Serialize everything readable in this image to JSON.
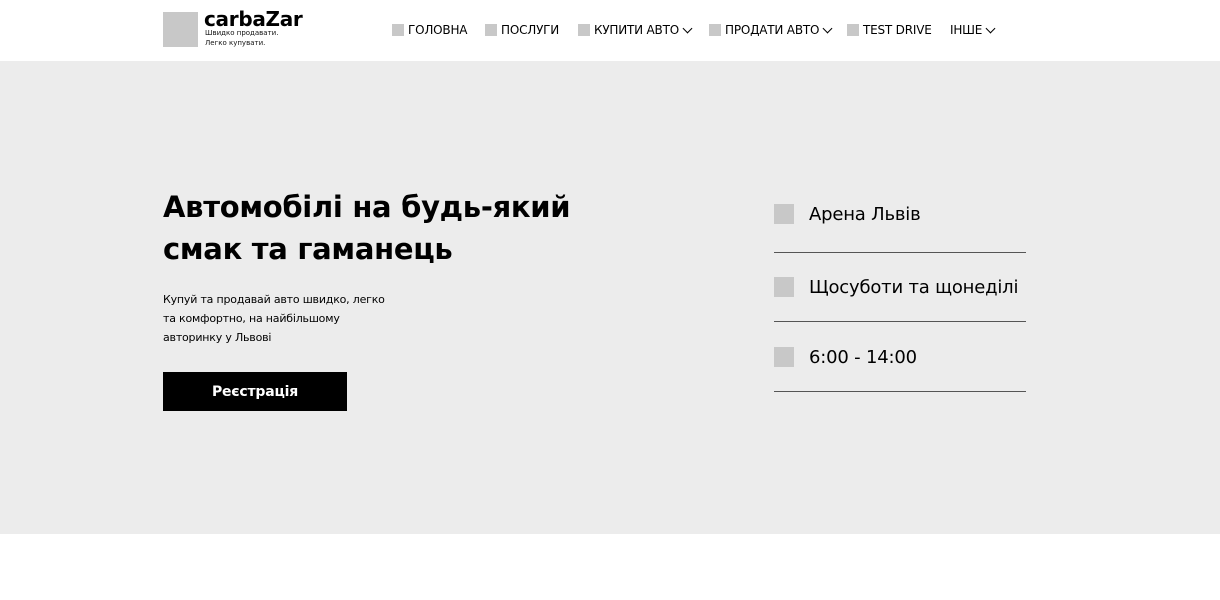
{
  "header": {
    "logo_name": "carbaZar",
    "logo_tagline_1": "Швидко продавати.",
    "logo_tagline_2": "Легко купувати.",
    "nav": [
      {
        "label": "ГОЛОВНА",
        "icon": "square-icon",
        "dropdown": false
      },
      {
        "label": "ПОСЛУГИ",
        "icon": "square-icon",
        "dropdown": false
      },
      {
        "label": "КУПИТИ АВТО",
        "icon": "square-icon",
        "dropdown": true
      },
      {
        "label": "ПРОДАТИ АВТО",
        "icon": "square-icon",
        "dropdown": true
      },
      {
        "label": "TEST DRIVE",
        "icon": "square-icon",
        "dropdown": false
      },
      {
        "label": "ІНШЕ",
        "icon": null,
        "dropdown": true
      }
    ]
  },
  "hero": {
    "title_line1": "Автомобілі на будь-який",
    "title_line2": "смак та гаманець",
    "text_line1": "Купуй та продавай авто швидко, легко",
    "text_line2": "та комфортно, на найбільшому",
    "text_line3": "авторинку у Львові",
    "button_label": "Реєстрація",
    "info": [
      {
        "icon": "location-icon",
        "text": "Арена Львів"
      },
      {
        "icon": "calendar-icon",
        "text": "Щосуботи та щонеділі"
      },
      {
        "icon": "clock-icon",
        "text": "6:00 - 14:00"
      }
    ]
  },
  "colors": {
    "hero_background": "#ececec",
    "icon_placeholder": "#c8c8c8",
    "button_background": "#000000",
    "button_text": "#ffffff"
  }
}
